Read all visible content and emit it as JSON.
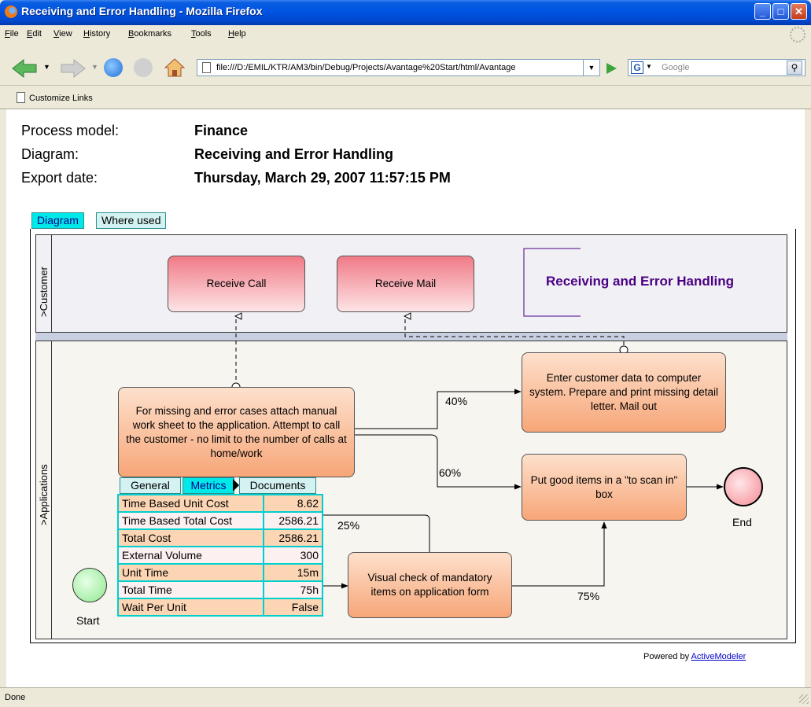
{
  "window": {
    "title": "Receiving and Error Handling - Mozilla Firefox"
  },
  "menu": [
    "File",
    "Edit",
    "View",
    "History",
    "Bookmarks",
    "Tools",
    "Help"
  ],
  "navbar": {
    "url": "file:///D:/EMIL/KTR/AM3/bin/Debug/Projects/Avantage%20Start/html/Avantage",
    "search_placeholder": "Google",
    "search_engine_letter": "G"
  },
  "links_bar": {
    "item": "Customize Links"
  },
  "meta": {
    "process_label": "Process model:",
    "process_value": "Finance",
    "diagram_label": "Diagram:",
    "diagram_value": "Receiving and Error Handling",
    "export_label": "Export date:",
    "export_value": "Thursday, March 29, 2007 11:57:15 PM"
  },
  "tabs": {
    "diagram": "Diagram",
    "where_used": "Where used"
  },
  "lanes": {
    "customer": ">Customer",
    "applications": ">Applications"
  },
  "diagram": {
    "title": "Receiving and Error Handling",
    "receive_call": "Receive Call",
    "receive_mail": "Receive Mail",
    "enter_data": "Enter customer data to computer system. Prepare and print missing detail letter. Mail out",
    "missing_error": "For missing and error cases attach manual work sheet to the application. Attempt to call the customer - no limit to the number of calls at home/work",
    "good_items": "Put good items in a \"to scan in\" box",
    "visual_check": "Visual check of mandatory items on application form",
    "start": "Start",
    "end": "End",
    "pct_40": "40%",
    "pct_60": "60%",
    "pct_25": "25%",
    "pct_75": "75%"
  },
  "popup": {
    "tabs": {
      "general": "General",
      "metrics": "Metrics",
      "documents": "Documents"
    },
    "rows": [
      {
        "label": "Time Based Unit Cost",
        "value": "8.62"
      },
      {
        "label": "Time Based Total Cost",
        "value": "2586.21"
      },
      {
        "label": "Total Cost",
        "value": "2586.21"
      },
      {
        "label": "External Volume",
        "value": "300"
      },
      {
        "label": "Unit Time",
        "value": "15m"
      },
      {
        "label": "Total Time",
        "value": "75h"
      },
      {
        "label": "Wait Per Unit",
        "value": "False"
      }
    ]
  },
  "footer": {
    "powered_by": "Powered by",
    "link": "ActiveModeler"
  },
  "status": {
    "text": "Done"
  },
  "colors": {
    "accent_tab": "#00e8e8",
    "task_red": "#f07a86",
    "task_orange": "#f7a678",
    "title_purple": "#4b0082",
    "link": "#0000cc"
  }
}
